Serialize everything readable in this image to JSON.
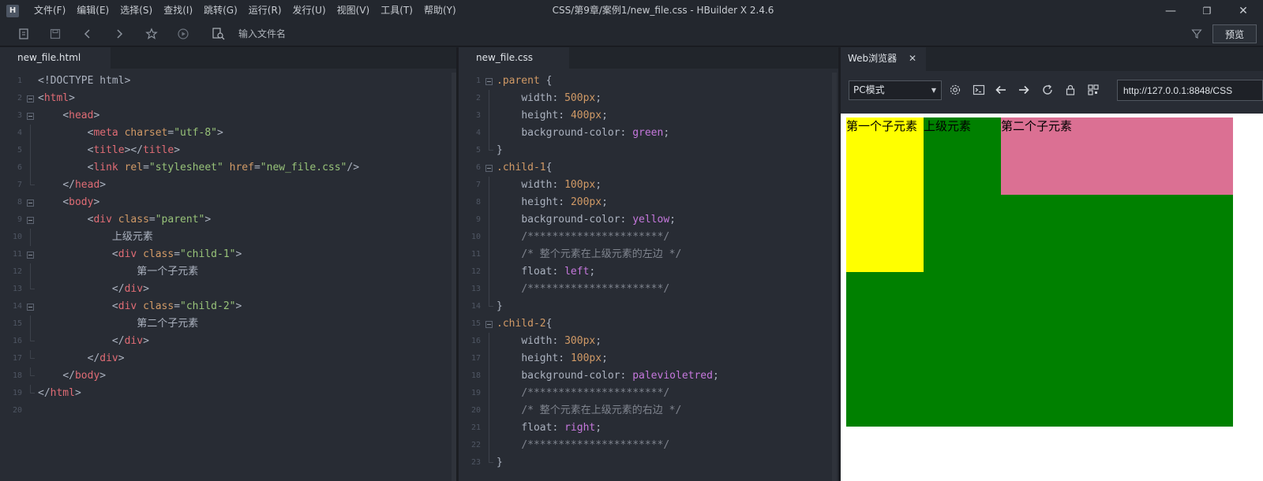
{
  "app": {
    "logo_text": "H",
    "menu": [
      "文件(F)",
      "编辑(E)",
      "选择(S)",
      "查找(I)",
      "跳转(G)",
      "运行(R)",
      "发行(U)",
      "视图(V)",
      "工具(T)",
      "帮助(Y)"
    ],
    "window_title": "CSS/第9章/案例1/new_file.css - HBuilder X 2.4.6",
    "controls": {
      "minimize": "—",
      "maximize": "❐",
      "close": "✕"
    }
  },
  "toolbar": {
    "icons": [
      "new-file-icon",
      "save-icon",
      "back-icon",
      "forward-icon",
      "star-icon",
      "run-icon",
      "search-file-icon",
      "filter-icon"
    ],
    "search_placeholder": "输入文件名",
    "preview_label": "预览"
  },
  "editor_html": {
    "tab_label": "new_file.html",
    "lines": [
      [
        [
          "punc",
          "<!DOCTYPE html>"
        ]
      ],
      [
        [
          "punc",
          "<"
        ],
        [
          "tag",
          "html"
        ],
        [
          "punc",
          ">"
        ]
      ],
      [
        [
          "plain",
          "    "
        ],
        [
          "punc",
          "<"
        ],
        [
          "tag",
          "head"
        ],
        [
          "punc",
          ">"
        ]
      ],
      [
        [
          "plain",
          "        "
        ],
        [
          "punc",
          "<"
        ],
        [
          "tag",
          "meta "
        ],
        [
          "attr",
          "charset"
        ],
        [
          "punc",
          "="
        ],
        [
          "str",
          "\"utf-8\""
        ],
        [
          "punc",
          ">"
        ]
      ],
      [
        [
          "plain",
          "        "
        ],
        [
          "punc",
          "<"
        ],
        [
          "tag",
          "title"
        ],
        [
          "punc",
          "></"
        ],
        [
          "tag",
          "title"
        ],
        [
          "punc",
          ">"
        ]
      ],
      [
        [
          "plain",
          "        "
        ],
        [
          "punc",
          "<"
        ],
        [
          "tag",
          "link "
        ],
        [
          "attr",
          "rel"
        ],
        [
          "punc",
          "="
        ],
        [
          "str",
          "\"stylesheet\" "
        ],
        [
          "attr",
          "href"
        ],
        [
          "punc",
          "="
        ],
        [
          "str",
          "\"new_file.css\""
        ],
        [
          "punc",
          "/>"
        ]
      ],
      [
        [
          "plain",
          "    "
        ],
        [
          "punc",
          "</"
        ],
        [
          "tag",
          "head"
        ],
        [
          "punc",
          ">"
        ]
      ],
      [
        [
          "plain",
          "    "
        ],
        [
          "punc",
          "<"
        ],
        [
          "tag",
          "body"
        ],
        [
          "punc",
          ">"
        ]
      ],
      [
        [
          "plain",
          "        "
        ],
        [
          "punc",
          "<"
        ],
        [
          "tag",
          "div "
        ],
        [
          "attr",
          "class"
        ],
        [
          "punc",
          "="
        ],
        [
          "str",
          "\"parent\""
        ],
        [
          "punc",
          ">"
        ]
      ],
      [
        [
          "plain",
          "            上级元素"
        ]
      ],
      [
        [
          "plain",
          "            "
        ],
        [
          "punc",
          "<"
        ],
        [
          "tag",
          "div "
        ],
        [
          "attr",
          "class"
        ],
        [
          "punc",
          "="
        ],
        [
          "str",
          "\"child-1\""
        ],
        [
          "punc",
          ">"
        ]
      ],
      [
        [
          "plain",
          "                第一个子元素"
        ]
      ],
      [
        [
          "plain",
          "            "
        ],
        [
          "punc",
          "</"
        ],
        [
          "tag",
          "div"
        ],
        [
          "punc",
          ">"
        ]
      ],
      [
        [
          "plain",
          "            "
        ],
        [
          "punc",
          "<"
        ],
        [
          "tag",
          "div "
        ],
        [
          "attr",
          "class"
        ],
        [
          "punc",
          "="
        ],
        [
          "str",
          "\"child-2\""
        ],
        [
          "punc",
          ">"
        ]
      ],
      [
        [
          "plain",
          "                第二个子元素"
        ]
      ],
      [
        [
          "plain",
          "            "
        ],
        [
          "punc",
          "</"
        ],
        [
          "tag",
          "div"
        ],
        [
          "punc",
          ">"
        ]
      ],
      [
        [
          "plain",
          "        "
        ],
        [
          "punc",
          "</"
        ],
        [
          "tag",
          "div"
        ],
        [
          "punc",
          ">"
        ]
      ],
      [
        [
          "plain",
          "    "
        ],
        [
          "punc",
          "</"
        ],
        [
          "tag",
          "body"
        ],
        [
          "punc",
          ">"
        ]
      ],
      [
        [
          "punc",
          "</"
        ],
        [
          "tag",
          "html"
        ],
        [
          "punc",
          ">"
        ]
      ],
      []
    ],
    "folds": [
      "",
      "box",
      "box",
      "v",
      "v",
      "v",
      "end",
      "box",
      "box",
      "v",
      "box",
      "v",
      "end",
      "box",
      "v",
      "end",
      "end",
      "end",
      "end",
      ""
    ]
  },
  "editor_css": {
    "tab_label": "new_file.css",
    "lines": [
      [
        [
          "sel",
          ".parent "
        ],
        [
          "punc",
          "{"
        ]
      ],
      [
        [
          "plain",
          "    "
        ],
        [
          "prop",
          "width"
        ],
        [
          "punc",
          ": "
        ],
        [
          "num",
          "500px"
        ],
        [
          "punc",
          ";"
        ]
      ],
      [
        [
          "plain",
          "    "
        ],
        [
          "prop",
          "height"
        ],
        [
          "punc",
          ": "
        ],
        [
          "num",
          "400px"
        ],
        [
          "punc",
          ";"
        ]
      ],
      [
        [
          "plain",
          "    "
        ],
        [
          "prop",
          "background-color"
        ],
        [
          "punc",
          ": "
        ],
        [
          "kw",
          "green"
        ],
        [
          "punc",
          ";"
        ]
      ],
      [
        [
          "punc",
          "}"
        ]
      ],
      [
        [
          "sel",
          ".child-1"
        ],
        [
          "punc",
          "{"
        ]
      ],
      [
        [
          "plain",
          "    "
        ],
        [
          "prop",
          "width"
        ],
        [
          "punc",
          ": "
        ],
        [
          "num",
          "100px"
        ],
        [
          "punc",
          ";"
        ]
      ],
      [
        [
          "plain",
          "    "
        ],
        [
          "prop",
          "height"
        ],
        [
          "punc",
          ": "
        ],
        [
          "num",
          "200px"
        ],
        [
          "punc",
          ";"
        ]
      ],
      [
        [
          "plain",
          "    "
        ],
        [
          "prop",
          "background-color"
        ],
        [
          "punc",
          ": "
        ],
        [
          "kw",
          "yellow"
        ],
        [
          "punc",
          ";"
        ]
      ],
      [
        [
          "plain",
          "    "
        ],
        [
          "cmt",
          "/**********************/"
        ]
      ],
      [
        [
          "plain",
          "    "
        ],
        [
          "cmt",
          "/* 整个元素在上级元素的左边 */"
        ]
      ],
      [
        [
          "plain",
          "    "
        ],
        [
          "prop",
          "float"
        ],
        [
          "punc",
          ": "
        ],
        [
          "kw",
          "left"
        ],
        [
          "punc",
          ";"
        ]
      ],
      [
        [
          "plain",
          "    "
        ],
        [
          "cmt",
          "/**********************/"
        ]
      ],
      [
        [
          "punc",
          "}"
        ]
      ],
      [
        [
          "sel",
          ".child-2"
        ],
        [
          "punc",
          "{"
        ]
      ],
      [
        [
          "plain",
          "    "
        ],
        [
          "prop",
          "width"
        ],
        [
          "punc",
          ": "
        ],
        [
          "num",
          "300px"
        ],
        [
          "punc",
          ";"
        ]
      ],
      [
        [
          "plain",
          "    "
        ],
        [
          "prop",
          "height"
        ],
        [
          "punc",
          ": "
        ],
        [
          "num",
          "100px"
        ],
        [
          "punc",
          ";"
        ]
      ],
      [
        [
          "plain",
          "    "
        ],
        [
          "prop",
          "background-color"
        ],
        [
          "punc",
          ": "
        ],
        [
          "kw",
          "palevioletred"
        ],
        [
          "punc",
          ";"
        ]
      ],
      [
        [
          "plain",
          "    "
        ],
        [
          "cmt",
          "/**********************/"
        ]
      ],
      [
        [
          "plain",
          "    "
        ],
        [
          "cmt",
          "/* 整个元素在上级元素的右边 */"
        ]
      ],
      [
        [
          "plain",
          "    "
        ],
        [
          "prop",
          "float"
        ],
        [
          "punc",
          ": "
        ],
        [
          "kw",
          "right"
        ],
        [
          "punc",
          ";"
        ]
      ],
      [
        [
          "plain",
          "    "
        ],
        [
          "cmt",
          "/**********************/"
        ]
      ],
      [
        [
          "punc",
          "}"
        ]
      ]
    ],
    "folds": [
      "box",
      "v",
      "v",
      "v",
      "end",
      "box",
      "v",
      "v",
      "v",
      "v",
      "v",
      "v",
      "v",
      "end",
      "box",
      "v",
      "v",
      "v",
      "v",
      "v",
      "v",
      "v",
      "end"
    ]
  },
  "browser": {
    "tab_label": "Web浏览器",
    "tab_close": "✕",
    "mode": "PC模式",
    "url": "http://127.0.0.1:8848/CSS",
    "render": {
      "parent_color": "#008000",
      "child1_color": "#ffff00",
      "child2_color": "#db7093",
      "parent_text": "上级元素",
      "child1_text": "第一个子元素",
      "child2_text": "第二个子元素"
    }
  }
}
